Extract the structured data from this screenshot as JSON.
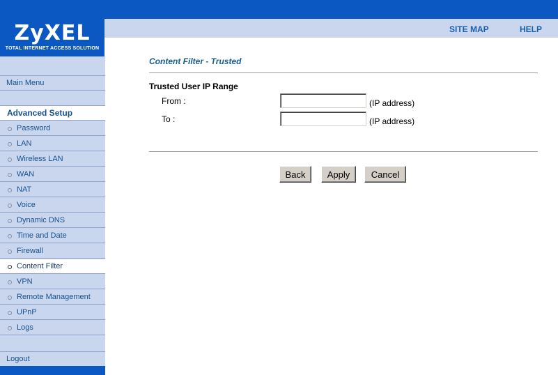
{
  "brand": {
    "name": "ZyXEL",
    "tagline": "TOTAL INTERNET ACCESS SOLUTION",
    "color": "#0b58c2"
  },
  "top_links": {
    "site_map": "SITE MAP",
    "help": "HELP"
  },
  "sidebar": {
    "main_menu": "Main Menu",
    "section_header": "Advanced Setup",
    "items": [
      {
        "label": "Password",
        "active": false
      },
      {
        "label": "LAN",
        "active": false
      },
      {
        "label": "Wireless LAN",
        "active": false
      },
      {
        "label": "WAN",
        "active": false
      },
      {
        "label": "NAT",
        "active": false
      },
      {
        "label": "Voice",
        "active": false
      },
      {
        "label": "Dynamic DNS",
        "active": false
      },
      {
        "label": "Time and Date",
        "active": false
      },
      {
        "label": "Firewall",
        "active": false
      },
      {
        "label": "Content Filter",
        "active": true
      },
      {
        "label": "VPN",
        "active": false
      },
      {
        "label": "Remote Management",
        "active": false
      },
      {
        "label": "UPnP",
        "active": false
      },
      {
        "label": "Logs",
        "active": false
      }
    ],
    "logout": "Logout"
  },
  "main": {
    "title": "Content Filter - Trusted",
    "section_title": "Trusted User IP Range",
    "from_label": "From :",
    "to_label": "To :",
    "from_value": "",
    "to_value": "",
    "ip_hint": "(IP address)"
  },
  "buttons": {
    "back": "Back",
    "apply": "Apply",
    "cancel": "Cancel"
  }
}
